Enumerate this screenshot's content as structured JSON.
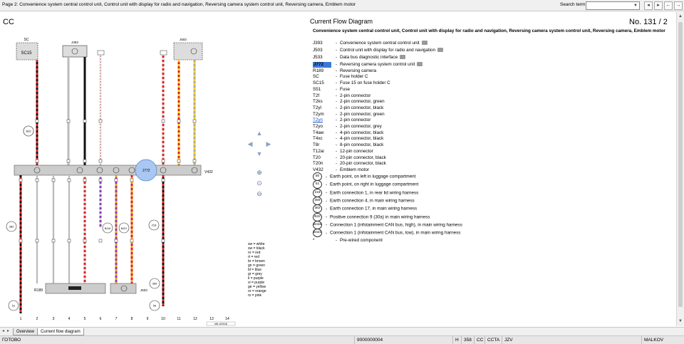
{
  "window": {
    "title": "Page 2: Convenience system central control unit, Control unit with display for radio and navigation, Reversing camera system control unit, Reversing camera, Emblem motor",
    "search_label": "Search term:",
    "search_value": ""
  },
  "header": {
    "left": "CC",
    "center": "Current Flow Diagram",
    "right": "No.  131 / 2"
  },
  "legend": {
    "title": "Convenience system central control unit, Control unit with display for radio and navigation, Reversing camera system control unit, Reversing camera, Emblem motor",
    "items": [
      {
        "code": "J393",
        "text": "Convenience system central control unit",
        "camera": true
      },
      {
        "code": "J503",
        "text": "Control unit with display for radio and navigation",
        "camera": true
      },
      {
        "code": "J533",
        "text": "Data bus diagnostic interface",
        "camera": true
      },
      {
        "code": "J772",
        "text": "Reversing camera system control unit",
        "camera": true
      },
      {
        "code": "R189",
        "text": "Reversing camera",
        "camera": false
      },
      {
        "code": "SC",
        "text": "Fuse holder C",
        "camera": false
      },
      {
        "code": "SC15",
        "text": "Fuse 15 on fuse holder C",
        "camera": false
      },
      {
        "code": "S51",
        "text": "Fuse",
        "camera": false
      },
      {
        "code": "T2f",
        "text": "2-pin connector",
        "camera": false
      },
      {
        "code": "T2ks",
        "text": "2-pin connector, green",
        "camera": false
      },
      {
        "code": "T2yl",
        "text": "2-pin connector, black",
        "camera": false
      },
      {
        "code": "T2ym",
        "text": "2-pin connector, green",
        "camera": false
      },
      {
        "code": "T2yn",
        "text": "2-pin connector",
        "camera": false
      },
      {
        "code": "T2yo",
        "text": "2-pin connector, grey",
        "camera": false
      },
      {
        "code": "T4aw",
        "text": "4-pin connector, black",
        "camera": false
      },
      {
        "code": "T4xc",
        "text": "4-pin connector, black",
        "camera": false
      },
      {
        "code": "T8r",
        "text": "8-pin connector, black",
        "camera": false
      },
      {
        "code": "T12ai",
        "text": "12-pin connector",
        "camera": false
      },
      {
        "code": "T20",
        "text": "20-pin connector, black",
        "camera": false
      },
      {
        "code": "T20n",
        "text": "20-pin connector, black",
        "camera": false
      },
      {
        "code": "V432",
        "text": "Emblem motor",
        "camera": false
      }
    ],
    "earth_items": [
      {
        "num": "50",
        "text": "Earth point, on left in luggage compartment"
      },
      {
        "num": "51",
        "text": "Earth point, on right in luggage compartment"
      },
      {
        "num": "218",
        "text": "Earth connection 1, in rear lid wiring harness"
      },
      {
        "num": "369",
        "text": "Earth connection 4, in main wiring harness"
      },
      {
        "num": "382",
        "text": "Earth connection 17, in main wiring harness"
      },
      {
        "num": "B32",
        "text": "Positive connection 9 (30a) in main wiring harness"
      },
      {
        "num": "B416",
        "text": "Connection 1 (infotainment CAN bus, high), in main wiring harness"
      },
      {
        "num": "B421",
        "text": "Connection 1 (infotainment CAN bus, low), in main wiring harness"
      }
    ],
    "prewired": {
      "mark": "*",
      "text": "Pre-wired component"
    }
  },
  "diagram": {
    "top_labels": [
      "SC",
      "J393",
      "J533",
      "S51",
      "J503"
    ],
    "sc15": "SC15",
    "bottom_components": [
      "R189",
      "J503"
    ],
    "bus_left_label": "V432",
    "j772": "J772",
    "column_numbers": [
      "1",
      "2",
      "3",
      "4",
      "5",
      "6",
      "7",
      "8",
      "9",
      "10",
      "11",
      "12",
      "13",
      "14"
    ],
    "earth_circles": [
      "51",
      "50",
      "382",
      "218",
      "369",
      "B32"
    ],
    "small_circles": [
      "B416",
      "B421"
    ],
    "part_number": "M6-102018",
    "wire_colors": [
      "sw = white",
      "sw = black",
      "ro = red",
      "rt = red",
      "br = brown",
      "gn = green",
      "bl = blue",
      "gr = grey",
      "li = purple",
      "vi = purple",
      "ge = yellow",
      "or = orange",
      "rs = pink"
    ]
  },
  "tabs": [
    {
      "label": "Overview",
      "active": false
    },
    {
      "label": "Current flow diagram",
      "active": true
    }
  ],
  "status": {
    "left": "ГОТОВО",
    "code": "9000000004",
    "seg1": "H",
    "seg2": "358",
    "seg3": "CC",
    "seg4": "CCTA",
    "seg5": "JZV",
    "right": "MALKOV"
  }
}
